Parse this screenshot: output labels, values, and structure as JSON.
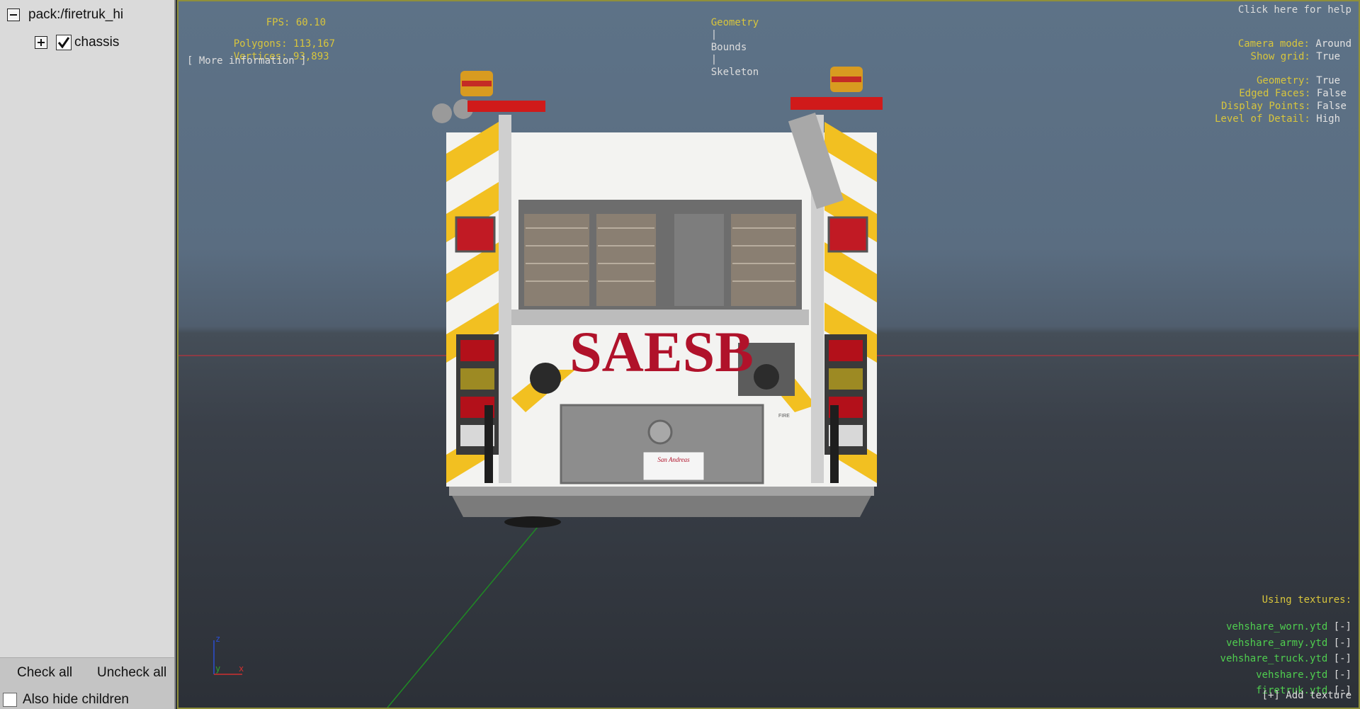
{
  "tree": {
    "root": {
      "label": "pack:/firetruk_hi"
    },
    "child": {
      "label": "chassis",
      "checked": true
    }
  },
  "sidebar_footer": {
    "check_all": "Check all",
    "uncheck_all": "Uncheck all",
    "also_hide": "Also hide children"
  },
  "hud": {
    "fps_label": "FPS:",
    "fps_value": "60.10",
    "polygons_label": "Polygons:",
    "polygons_value": "113,167",
    "vertices_label": "Vertices:",
    "vertices_value": "93,893",
    "more_info": "[ More information ]",
    "tabs": [
      "Geometry",
      "Bounds",
      "Skeleton"
    ],
    "tab_sep": "|",
    "help": "Click here for help",
    "settings": [
      {
        "label": "Camera mode:",
        "value": "Around"
      },
      {
        "label": "Show grid:",
        "value": "True"
      },
      {
        "label": "Geometry:",
        "value": "True"
      },
      {
        "label": "Edged Faces:",
        "value": "False"
      },
      {
        "label": "Display Points:",
        "value": "False"
      },
      {
        "label": "Level of Detail:",
        "value": "High"
      }
    ]
  },
  "textures": {
    "heading": "Using textures:",
    "remove": "[-]",
    "items": [
      "vehshare_worn.ytd",
      "vehshare_army.ytd",
      "vehshare_truck.ytd",
      "vehshare.ytd",
      "firetruk.ytd"
    ],
    "add": "[+] Add texture"
  },
  "model": {
    "rear_text": "SAESB",
    "plate_text": "San Andreas",
    "badge_text": "FIRE"
  },
  "axes": {
    "z": "z",
    "y": "y",
    "x": "x"
  },
  "colors": {
    "hud_yellow": "#d8c53c",
    "texture_green": "#4fce4f",
    "truck_red": "#b0122a",
    "stripe_yellow": "#f2c021"
  }
}
